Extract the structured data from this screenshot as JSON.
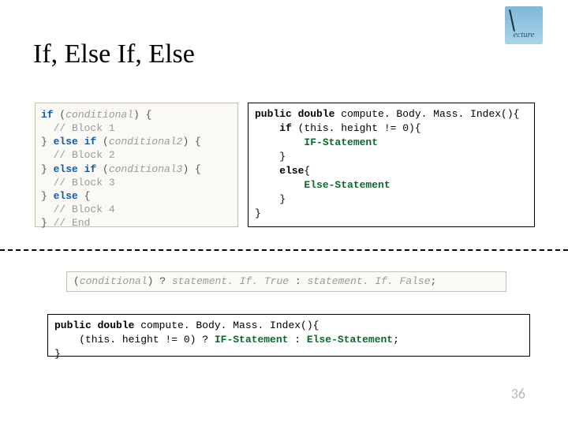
{
  "logo": {
    "text": "ecture"
  },
  "title": "If, Else If, Else",
  "codeLeft": {
    "l1_kw": "if",
    "l1_open": " (",
    "l1_cond": "conditional",
    "l1_close": ") {",
    "l2": "  // Block 1",
    "l3a": "} ",
    "l3_kw": "else if",
    "l3b": " (",
    "l3_cond": "conditional2",
    "l3c": ") {",
    "l4": "  // Block 2",
    "l5a": "} ",
    "l5_kw": "else if",
    "l5b": " (",
    "l5_cond": "conditional3",
    "l5c": ") {",
    "l6": "  // Block 3",
    "l7a": "} ",
    "l7_kw": "else",
    "l7b": " {",
    "l8": "  // Block 4",
    "l9a": "} ",
    "l9b": "// End"
  },
  "codeRight": {
    "l1a": "public double ",
    "l1b": "compute. Body. Mass. Index(){",
    "l2a": "    if ",
    "l2b": "(this. height != 0){",
    "l3": "IF-Statement",
    "l4": "    }",
    "l5a": "    else",
    "l5b": "{",
    "l6": "Else-Statement",
    "l7": "    }",
    "l8": "}"
  },
  "ternary": {
    "open": "(",
    "cond": "conditional",
    "close": ") ? ",
    "t": "statement. If. True",
    "sep": " : ",
    "f": "statement. If. False",
    "semi": ";"
  },
  "codeBottom": {
    "l1a": "public double ",
    "l1b": "compute. Body. Mass. Index(){",
    "l2a": "    (this. height != 0) ? ",
    "l2_if": "IF-Statement",
    "l2_sep": " : ",
    "l2_else": "Else-Statement",
    "l2_semi": ";",
    "l3": "}"
  },
  "pageNumber": "36"
}
